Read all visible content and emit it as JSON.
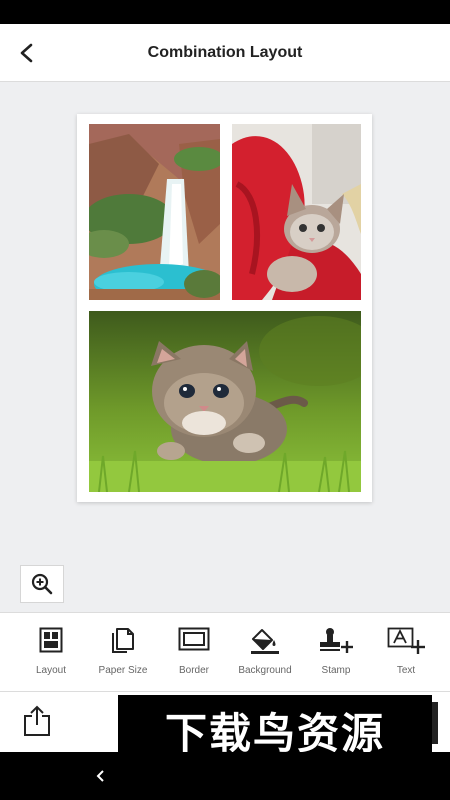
{
  "header": {
    "title": "Combination Layout",
    "back_icon": "chevron-left-icon"
  },
  "collage": {
    "photos": [
      {
        "name": "waterfall-photo",
        "subject": "waterfall"
      },
      {
        "name": "kitten-red-blanket-photo",
        "subject": "kitten on red blanket"
      },
      {
        "name": "kitten-grass-photo",
        "subject": "kitten in grass"
      }
    ]
  },
  "zoom": {
    "icon": "zoom-in-icon"
  },
  "toolbar": {
    "items": [
      {
        "label": "Layout",
        "icon": "layout-icon"
      },
      {
        "label": "Paper Size",
        "icon": "paper-size-icon"
      },
      {
        "label": "Border",
        "icon": "border-icon"
      },
      {
        "label": "Background",
        "icon": "paint-bucket-icon"
      },
      {
        "label": "Stamp",
        "icon": "stamp-icon"
      },
      {
        "label": "Text",
        "icon": "add-text-icon"
      }
    ]
  },
  "bottom": {
    "share_icon": "share-icon",
    "watermark": "下载鸟资源"
  },
  "nav": {
    "back_icon": "nav-back-icon"
  },
  "colors": {
    "canvas_bg": "#eeeff1",
    "paper": "#ffffff",
    "text_dark": "#222222",
    "label_gray": "#666666"
  }
}
